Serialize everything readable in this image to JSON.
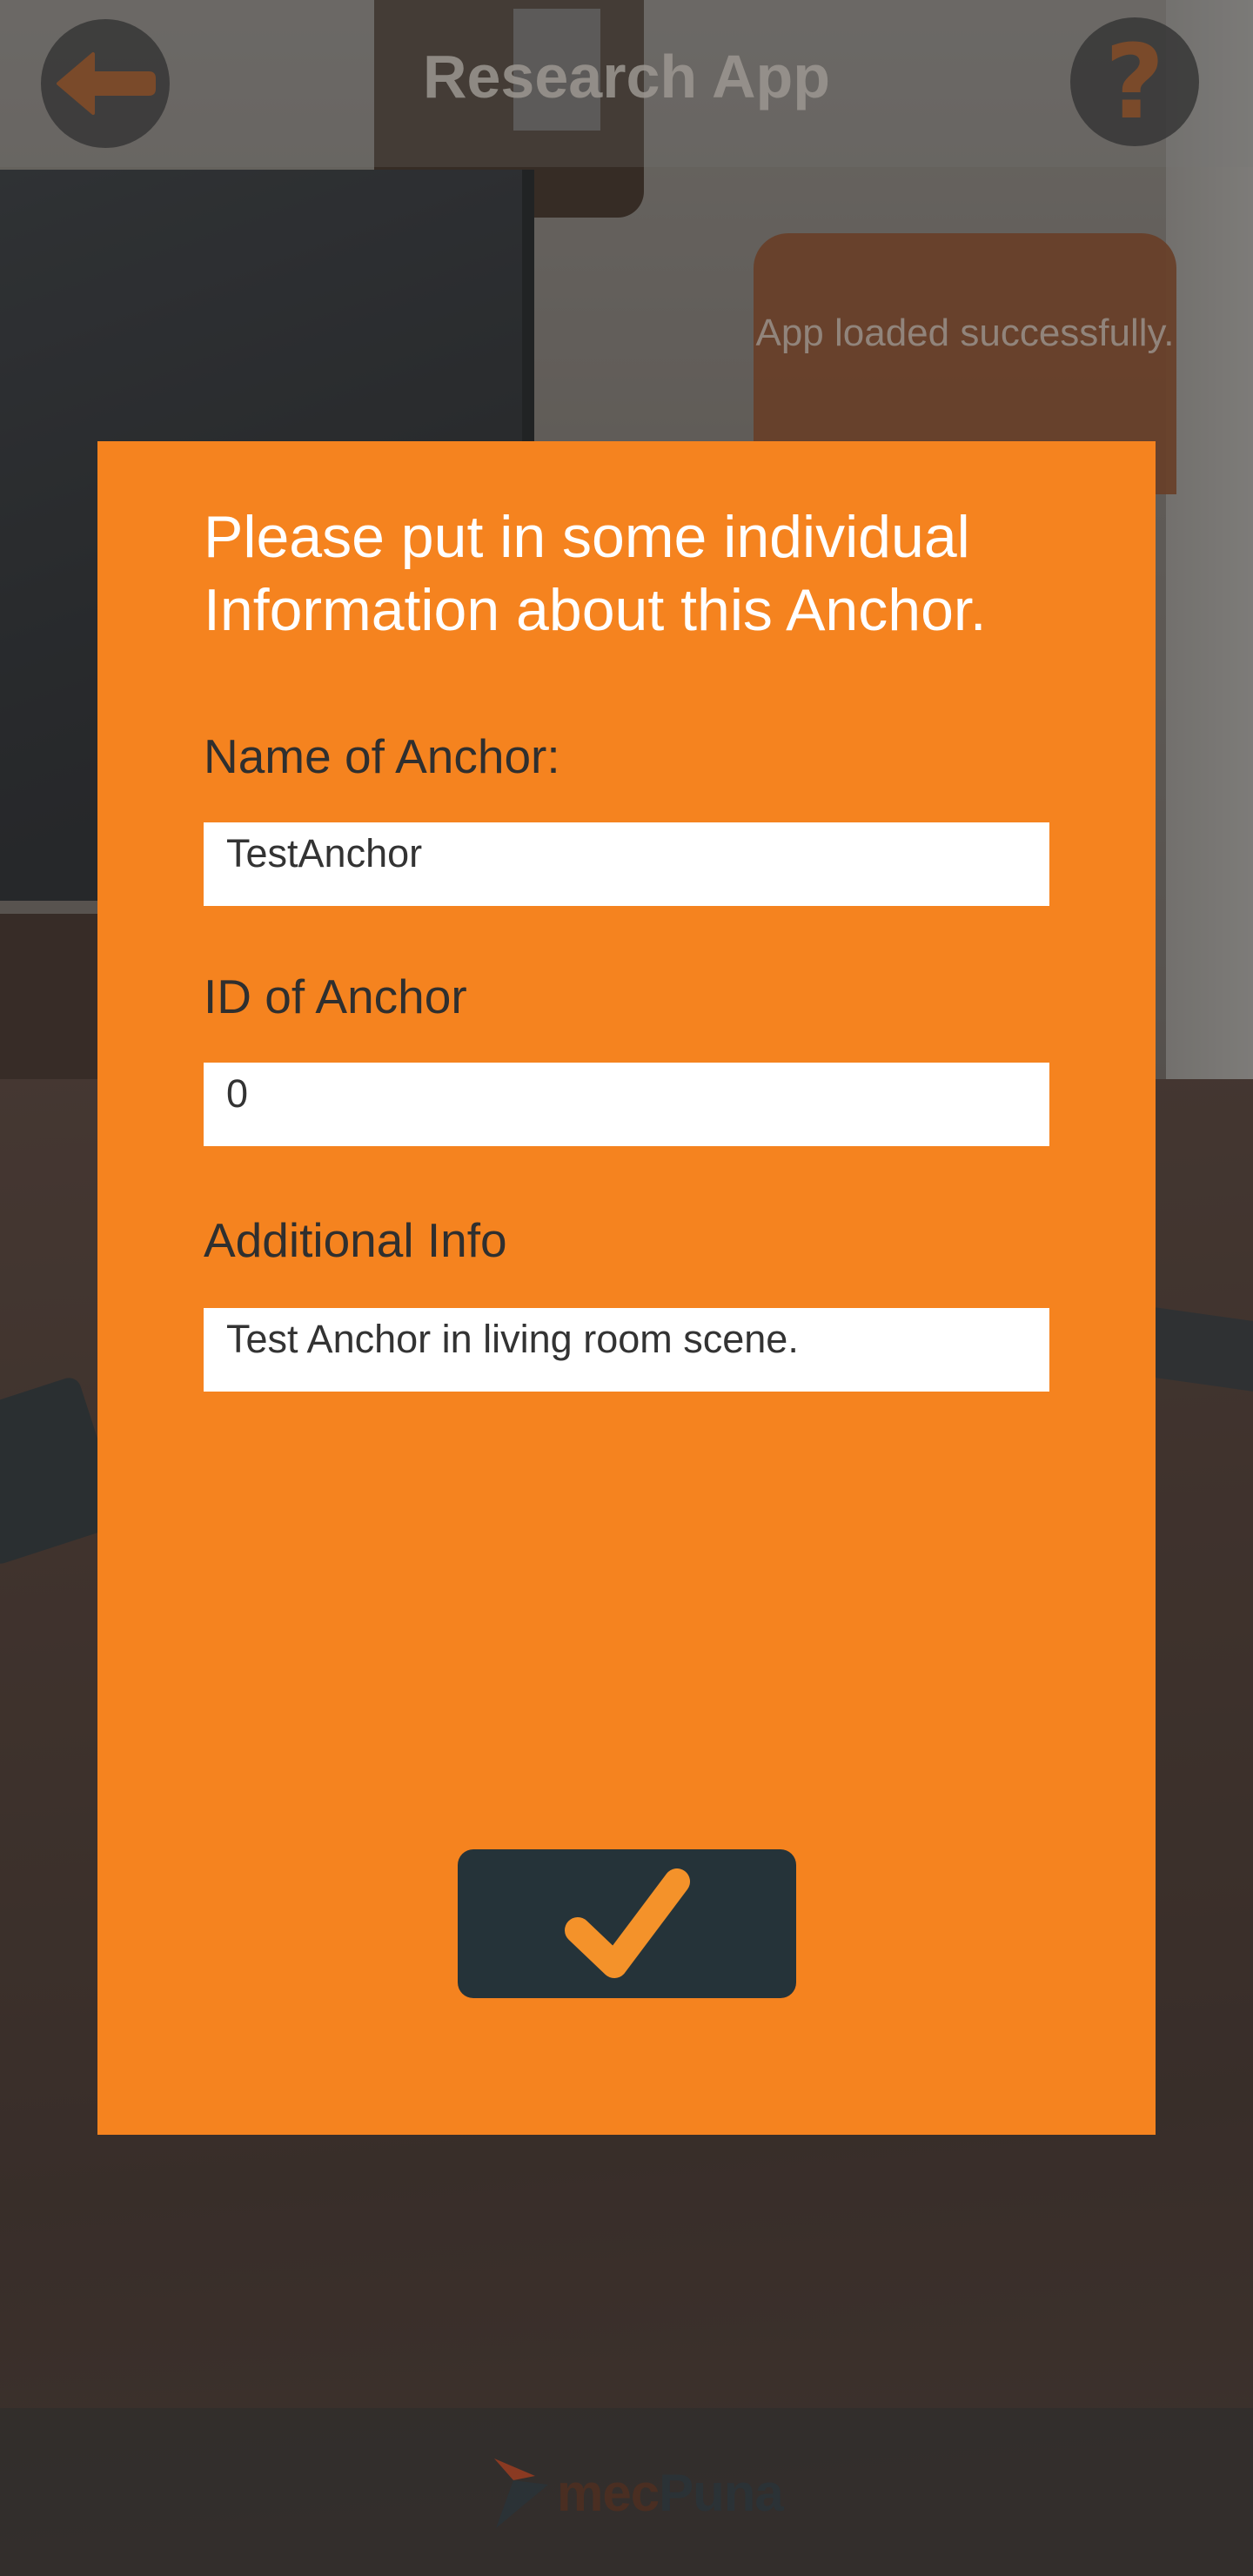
{
  "header": {
    "title": "Research App",
    "help_symbol": "?"
  },
  "toast": {
    "message": "App loaded successfully."
  },
  "dialog": {
    "title": "Please put in some individual Information about this Anchor.",
    "fields": [
      {
        "label": "Name of Anchor:",
        "value": "TestAnchor"
      },
      {
        "label": "ID of Anchor",
        "value": "0"
      },
      {
        "label": "Additional Info",
        "value": "Test Anchor in living room scene."
      }
    ],
    "confirm_icon": "checkmark-icon"
  },
  "footer": {
    "brand_part1": "mec",
    "brand_part2": "Puna"
  },
  "colors": {
    "dialog_bg": "#f5831f",
    "button_bg": "#253339",
    "check_color": "#f4922a",
    "toast_bg": "#683f28"
  }
}
